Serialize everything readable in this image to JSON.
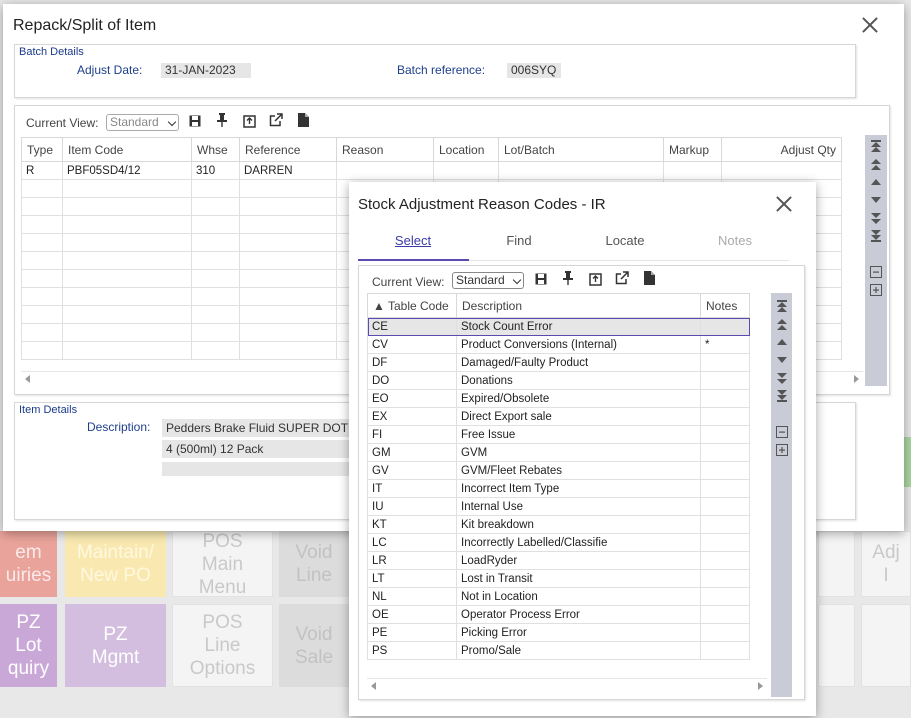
{
  "background": {
    "tiles": [
      {
        "label": "em\nuiries"
      },
      {
        "label": "Maintain/\nNew PO"
      },
      {
        "label": "POS\nMain\nMenu"
      },
      {
        "label": "Void\nLine"
      },
      {
        "label": "Adj\nI"
      },
      {
        "label": "PZ\nLot\nquiry"
      },
      {
        "label": "PZ\nMgmt"
      },
      {
        "label": "POS\nLine\nOptions"
      },
      {
        "label": "Void\nSale"
      }
    ]
  },
  "repack": {
    "title": "Repack/Split of Item",
    "batch": {
      "legend": "Batch Details",
      "adjust_date_label": "Adjust Date:",
      "adjust_date_value": "31-JAN-2023",
      "batch_ref_label": "Batch reference:",
      "batch_ref_value": "006SYQ"
    },
    "toolbar": {
      "view_label": "Current View:",
      "view_value": "Standard"
    },
    "grid": {
      "columns": [
        "Type",
        "Item Code",
        "Whse",
        "Reference",
        "Reason",
        "Location",
        "Lot/Batch",
        "Markup",
        "Adjust Qty"
      ],
      "rows": [
        [
          "R",
          "PBF05SD4/12",
          "310",
          "DARREN",
          "",
          "",
          "",
          "",
          ""
        ]
      ]
    },
    "item": {
      "legend": "Item Details",
      "description_label": "Description:",
      "description_line1": "Pedders Brake Fluid SUPER DOT",
      "description_line2": "4 (500ml) 12 Pack"
    }
  },
  "reason_dialog": {
    "title": "Stock Adjustment Reason Codes - IR",
    "tabs": [
      {
        "label": "Select",
        "state": "active"
      },
      {
        "label": "Find",
        "state": "normal"
      },
      {
        "label": "Locate",
        "state": "normal"
      },
      {
        "label": "Notes",
        "state": "disabled"
      }
    ],
    "toolbar": {
      "view_label": "Current View:",
      "view_value": "Standard"
    },
    "columns": [
      "▲ Table Code",
      "Description",
      "Notes"
    ],
    "rows": [
      [
        "CE",
        "Stock Count Error",
        ""
      ],
      [
        "CV",
        "Product Conversions (Internal)",
        "*"
      ],
      [
        "DF",
        "Damaged/Faulty Product",
        ""
      ],
      [
        "DO",
        "Donations",
        ""
      ],
      [
        "EO",
        "Expired/Obsolete",
        ""
      ],
      [
        "EX",
        "Direct Export sale",
        ""
      ],
      [
        "FI",
        "Free Issue",
        ""
      ],
      [
        "GM",
        "GVM",
        ""
      ],
      [
        "GV",
        "GVM/Fleet Rebates",
        ""
      ],
      [
        "IT",
        "Incorrect Item Type",
        ""
      ],
      [
        "IU",
        "Internal Use",
        ""
      ],
      [
        "KT",
        "Kit breakdown",
        ""
      ],
      [
        "LC",
        "Incorrectly Labelled/Classifie",
        ""
      ],
      [
        "LR",
        "LoadRyder",
        ""
      ],
      [
        "LT",
        "Lost in Transit",
        ""
      ],
      [
        "NL",
        "Not in Location",
        ""
      ],
      [
        "OE",
        "Operator Process Error",
        ""
      ],
      [
        "PE",
        "Picking Error",
        ""
      ],
      [
        "PS",
        "Promo/Sale",
        ""
      ]
    ],
    "selected_row": 0
  },
  "colors": {
    "accent": "#5a4bb0",
    "nav_strip": "#c9cbd6",
    "legend_blue": "#1a3a8a"
  }
}
